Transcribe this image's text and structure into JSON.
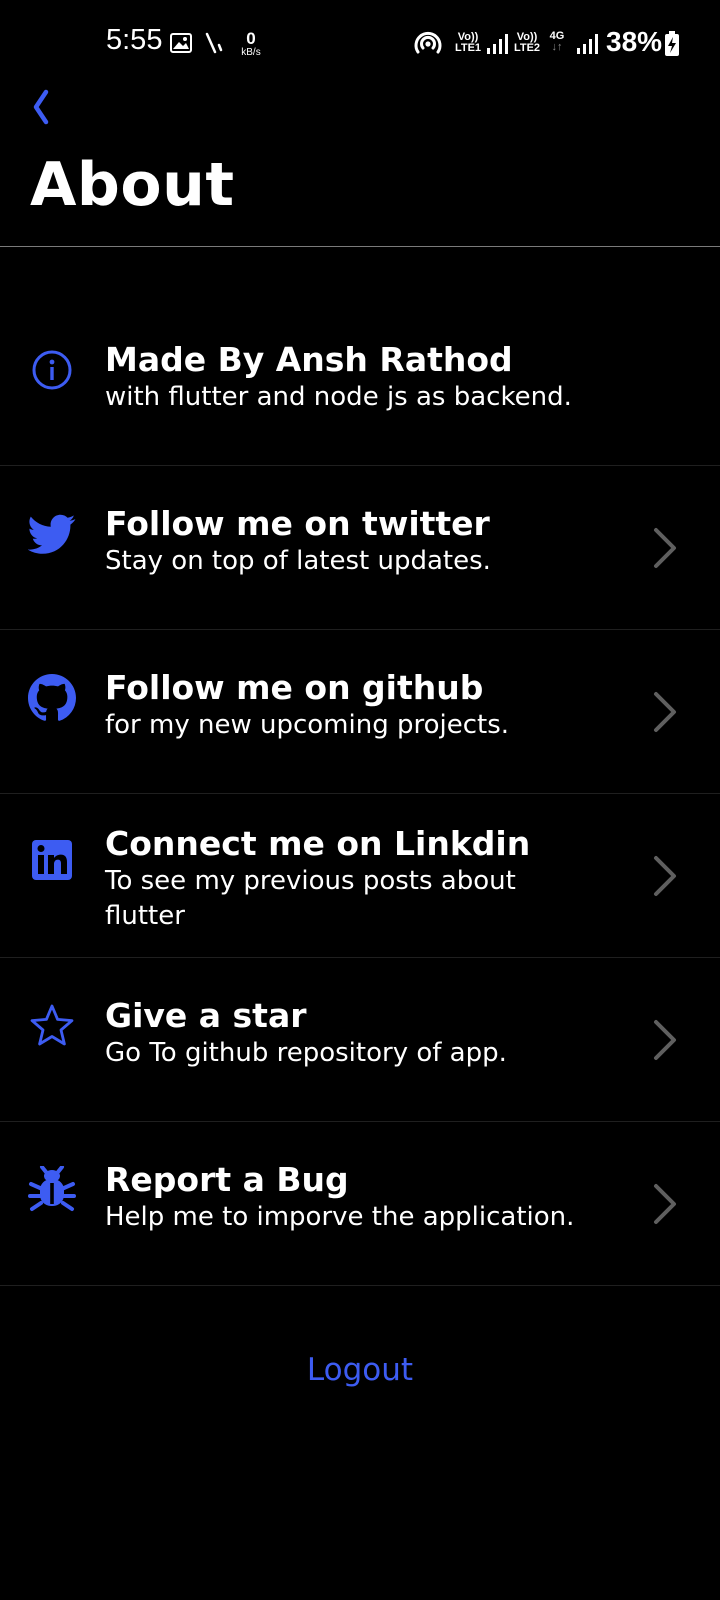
{
  "status_bar": {
    "time": "5:55",
    "speed_value": "0",
    "speed_unit": "kB/s",
    "sim1_label_top": "Vo))",
    "sim1_label_bottom": "LTE1",
    "sim2_label_top": "Vo))",
    "sim2_label_bottom": "LTE2",
    "network_type": "4G",
    "battery_percent": "38%"
  },
  "header": {
    "title": "About"
  },
  "items": [
    {
      "icon": "info-icon",
      "title": "Made By Ansh Rathod",
      "subtitle": "with flutter and node js as backend."
    },
    {
      "icon": "twitter-icon",
      "title": "Follow me on twitter",
      "subtitle": "Stay on top of latest updates."
    },
    {
      "icon": "github-icon",
      "title": "Follow me on github",
      "subtitle": "for my new upcoming projects."
    },
    {
      "icon": "linkedin-icon",
      "title": "Connect me on Linkdin",
      "subtitle": "To see my previous posts about flutter"
    },
    {
      "icon": "star-icon",
      "title": "Give a star",
      "subtitle": "Go To github repository of app."
    },
    {
      "icon": "bug-icon",
      "title": "Report a Bug",
      "subtitle": "Help me to imporve the application."
    }
  ],
  "logout_label": "Logout",
  "colors": {
    "accent": "#3d5cf2",
    "background": "#000000",
    "chevron": "#5f5f5f"
  }
}
